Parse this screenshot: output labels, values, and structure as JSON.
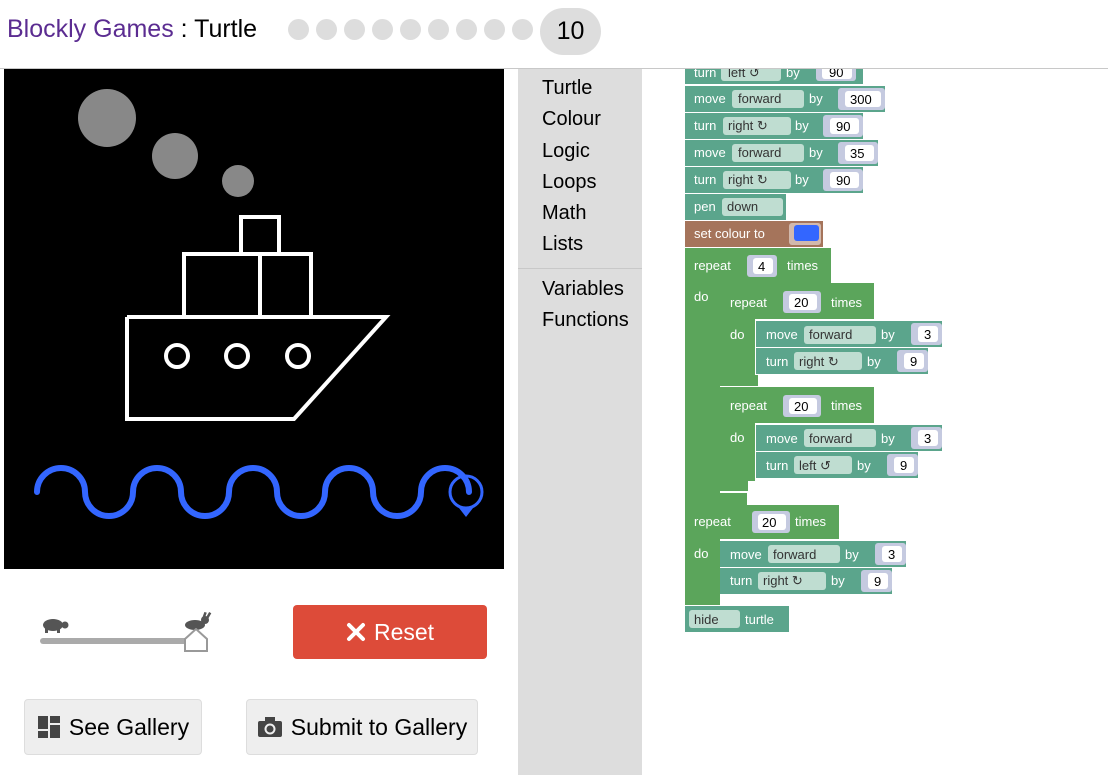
{
  "header": {
    "app_name": "Blockly Games",
    "separator": " : ",
    "game_name": "Turtle",
    "level_count": 9,
    "current_level": "10"
  },
  "controls": {
    "reset_label": "Reset",
    "see_gallery_label": "See Gallery",
    "submit_gallery_label": "Submit to Gallery",
    "speed_fraction": 1.0
  },
  "toolbox": {
    "categories": [
      "Turtle",
      "Colour",
      "Logic",
      "Loops",
      "Math",
      "Lists"
    ],
    "categories2": [
      "Variables",
      "Functions"
    ]
  },
  "blocks": {
    "turn": "turn",
    "move": "move",
    "by": "by",
    "pen": "pen",
    "set_colour": "set colour to",
    "repeat": "repeat",
    "times": "times",
    "do": "do",
    "hide": "hide",
    "turtle": "turtle",
    "forward": "forward",
    "left": "left ↺",
    "right": "right ↻",
    "down": "down",
    "v90": "90",
    "v300": "300",
    "v35": "35",
    "v4": "4",
    "v20": "20",
    "v3": "3",
    "v9": "9"
  },
  "colors": {
    "turtle_block": "#5ba58c",
    "loop_block": "#5ba55b",
    "colour_block": "#a5745b",
    "value_block": "#5b67a5",
    "pen_colour": "#3366ff",
    "reset": "#dd4b39",
    "title_link": "#5b2c91"
  }
}
